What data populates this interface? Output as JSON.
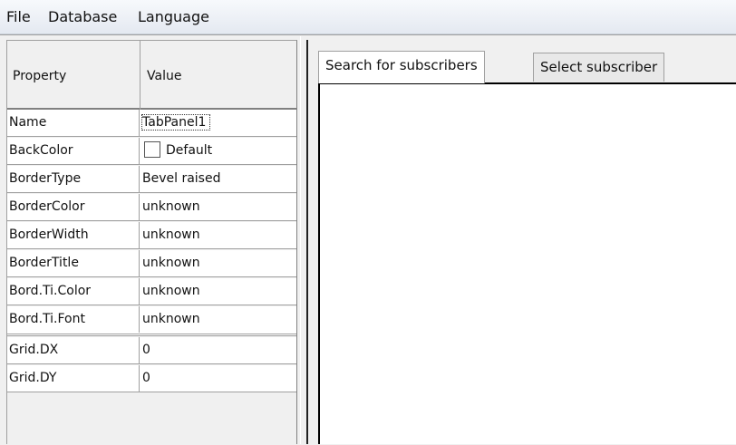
{
  "menu": {
    "items": [
      "File",
      "Database",
      "Language"
    ]
  },
  "property_grid": {
    "header": {
      "property": "Property",
      "value": "Value"
    },
    "rows": [
      {
        "name": "Name",
        "value": "TabPanel1"
      },
      {
        "name": "BackColor",
        "value": "Default"
      },
      {
        "name": "BorderType",
        "value": "Bevel raised"
      },
      {
        "name": "BorderColor",
        "value": "unknown"
      },
      {
        "name": "BorderWidth",
        "value": "unknown"
      },
      {
        "name": "BorderTitle",
        "value": "unknown"
      },
      {
        "name": "Bord.Ti.Color",
        "value": "unknown"
      },
      {
        "name": "Bord.Ti.Font",
        "value": "unknown"
      },
      {
        "name": "Grid.DX",
        "value": "0"
      },
      {
        "name": "Grid.DY",
        "value": "0"
      }
    ]
  },
  "tabs": [
    {
      "label": "Search for subscribers",
      "active": true
    },
    {
      "label": "Select subscriber",
      "active": false
    }
  ],
  "colors": {
    "menubar": "#e9eef5",
    "grid_lines": "#a0a0a0",
    "tab_content": "#ffffff"
  }
}
